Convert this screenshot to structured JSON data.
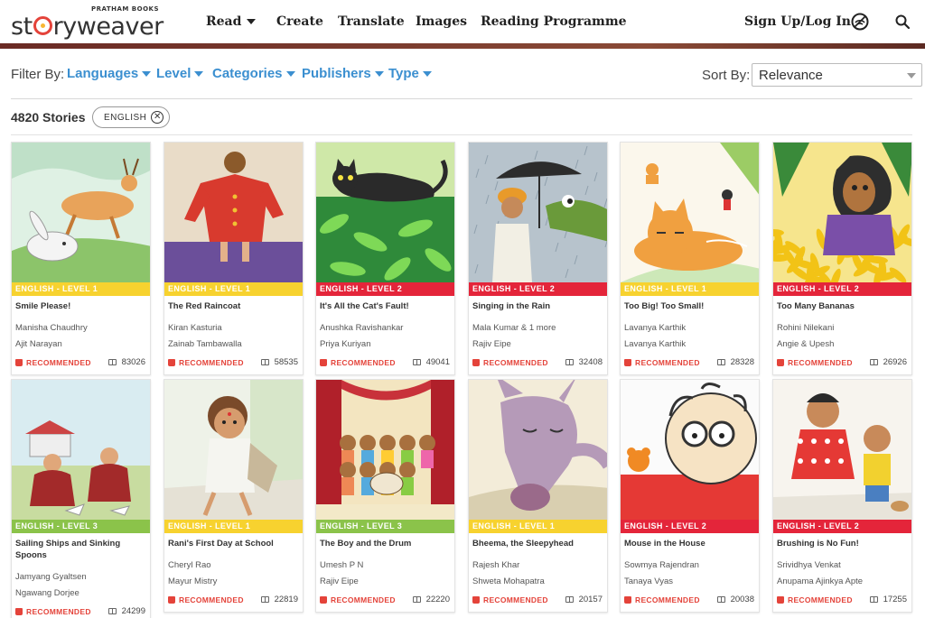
{
  "header": {
    "logo_text_left": "st",
    "logo_text_right": "ryweaver",
    "logo_small": "PRATHAM BOOKS",
    "nav": [
      {
        "label": "Read",
        "has_caret": true
      },
      {
        "label": "Create",
        "has_caret": false
      },
      {
        "label": "Translate",
        "has_caret": false
      },
      {
        "label": "Images",
        "has_caret": false
      },
      {
        "label": "Reading Programme",
        "has_caret": false
      }
    ],
    "signin_label": "Sign Up/Log In",
    "icons": [
      "offline-icon",
      "search-icon"
    ]
  },
  "filters": {
    "label": "Filter By:",
    "items": [
      "Languages",
      "Level",
      "Categories",
      "Publishers",
      "Type"
    ],
    "sort_label": "Sort By:",
    "sort_value": "Relevance"
  },
  "results": {
    "count": "4820 Stories",
    "chip": "ENGLISH"
  },
  "colors": {
    "level1": "#f7d22f",
    "level2": "#e4253a",
    "level3": "#8bc34a",
    "accent": "#3b8fd0",
    "recommended": "#e4433a"
  },
  "cards": [
    {
      "level": "ENGLISH - LEVEL 1",
      "level_num": 1,
      "title": "Smile Please!",
      "author": "Manisha Chaudhry",
      "illustrator": "Ajit Narayan",
      "tag": "RECOMMENDED",
      "reads": "83026",
      "cover": "deer-rabbit"
    },
    {
      "level": "ENGLISH - LEVEL 1",
      "level_num": 1,
      "title": "The Red Raincoat",
      "author": "Kiran Kasturia",
      "illustrator": "Zainab Tambawalla",
      "tag": "RECOMMENDED",
      "reads": "58535",
      "cover": "raincoat"
    },
    {
      "level": "ENGLISH - LEVEL 2",
      "level_num": 2,
      "title": "It's All the Cat's Fault!",
      "author": "Anushka Ravishankar",
      "illustrator": "Priya Kuriyan",
      "tag": "RECOMMENDED",
      "reads": "49041",
      "cover": "cat-leaves"
    },
    {
      "level": "ENGLISH - LEVEL 2",
      "level_num": 2,
      "title": "Singing in the Rain",
      "author": "Mala Kumar & 1 more",
      "illustrator": "Rajiv Eipe",
      "tag": "RECOMMENDED",
      "reads": "32408",
      "cover": "rain-umbrella"
    },
    {
      "level": "ENGLISH - LEVEL 1",
      "level_num": 1,
      "title": "Too Big! Too Small!",
      "author": "Lavanya Karthik",
      "illustrator": "Lavanya Karthik",
      "tag": "RECOMMENDED",
      "reads": "28328",
      "cover": "cats"
    },
    {
      "level": "ENGLISH - LEVEL 2",
      "level_num": 2,
      "title": "Too Many Bananas",
      "author": "Rohini Nilekani",
      "illustrator": "Angie & Upesh",
      "tag": "RECOMMENDED",
      "reads": "26926",
      "cover": "bananas"
    },
    {
      "level": "ENGLISH - LEVEL 3",
      "level_num": 3,
      "title": "Sailing Ships and Sinking Spoons",
      "author": "Jamyang Gyaltsen",
      "illustrator": "Ngawang Dorjee",
      "tag": "RECOMMENDED",
      "reads": "24299",
      "cover": "monks"
    },
    {
      "level": "ENGLISH - LEVEL 1",
      "level_num": 1,
      "title": "Rani's First Day at School",
      "author": "Cheryl Rao",
      "illustrator": "Mayur Mistry",
      "tag": "RECOMMENDED",
      "reads": "22819",
      "cover": "girl-school"
    },
    {
      "level": "ENGLISH - LEVEL 3",
      "level_num": 3,
      "title": "The Boy and the Drum",
      "author": "Umesh P N",
      "illustrator": "Rajiv Eipe",
      "tag": "RECOMMENDED",
      "reads": "22220",
      "cover": "drum-crowd"
    },
    {
      "level": "ENGLISH - LEVEL 1",
      "level_num": 1,
      "title": "Bheema, the Sleepyhead",
      "author": "Rajesh Khar",
      "illustrator": "Shweta Mohapatra",
      "tag": "RECOMMENDED",
      "reads": "20157",
      "cover": "donkey"
    },
    {
      "level": "ENGLISH - LEVEL 2",
      "level_num": 2,
      "title": "Mouse in the House",
      "author": "Sowmya Rajendran",
      "illustrator": "Tanaya Vyas",
      "tag": "RECOMMENDED",
      "reads": "20038",
      "cover": "man-mouse"
    },
    {
      "level": "ENGLISH - LEVEL 2",
      "level_num": 2,
      "title": "Brushing is No Fun!",
      "author": "Srividhya Venkat",
      "illustrator": "Anupama Ajinkya Apte",
      "tag": "RECOMMENDED",
      "reads": "17255",
      "cover": "kids-brushing"
    }
  ]
}
